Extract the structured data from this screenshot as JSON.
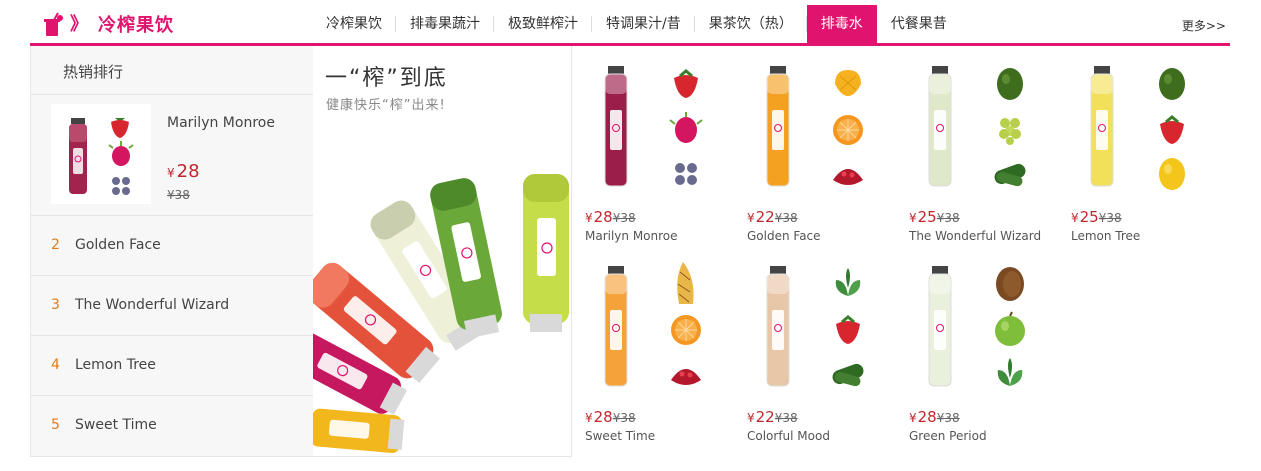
{
  "brand": {
    "arrow": "》",
    "title": "冷榨果饮",
    "icon": "juice-cup-icon",
    "accent": "#e0146e"
  },
  "nav": {
    "items": [
      {
        "label": "冷榨果饮",
        "active": false
      },
      {
        "label": "排毒果蔬汁",
        "active": false
      },
      {
        "label": "极致鲜榨汁",
        "active": false
      },
      {
        "label": "特调果汁/昔",
        "active": false
      },
      {
        "label": "果茶饮（热）",
        "active": false
      },
      {
        "label": "排毒水",
        "active": true
      },
      {
        "label": "代餐果昔",
        "active": false
      }
    ],
    "more": "更多>>"
  },
  "ranking": {
    "title": "热销排行",
    "top": {
      "name": "Marilyn Monroe",
      "yen": "¥",
      "price": "28",
      "old_price": "¥38"
    },
    "items": [
      {
        "num": "2",
        "name": "Golden Face"
      },
      {
        "num": "3",
        "name": "The Wonderful Wizard"
      },
      {
        "num": "4",
        "name": "Lemon Tree"
      },
      {
        "num": "5",
        "name": "Sweet Time"
      }
    ]
  },
  "banner": {
    "title": "一“榨”到底",
    "subtitle": "健康快乐“榨”出来!"
  },
  "products": [
    {
      "name": "Marilyn Monroe",
      "yen": "¥",
      "price": "28",
      "old_price": "¥38",
      "juice": "#9b1d4a",
      "fruits": [
        "strawberry",
        "dragonfruit",
        "blueberry"
      ]
    },
    {
      "name": "Golden Face",
      "yen": "¥",
      "price": "22",
      "old_price": "¥38",
      "juice": "#f4a020",
      "fruits": [
        "mango",
        "orange",
        "pomegranate"
      ]
    },
    {
      "name": "The Wonderful Wizard",
      "yen": "¥",
      "price": "25",
      "old_price": "¥38",
      "juice": "#dfe8c8",
      "fruits": [
        "lime",
        "grape",
        "cucumber"
      ]
    },
    {
      "name": "Lemon Tree",
      "yen": "¥",
      "price": "25",
      "old_price": "¥38",
      "juice": "#f3e05a",
      "fruits": [
        "lime",
        "strawberry",
        "lemon"
      ]
    },
    {
      "name": "Sweet Time",
      "yen": "¥",
      "price": "28",
      "old_price": "¥38",
      "juice": "#f6a23a",
      "fruits": [
        "pineapple",
        "orange",
        "pomegranate"
      ]
    },
    {
      "name": "Colorful Mood",
      "yen": "¥",
      "price": "22",
      "old_price": "¥38",
      "juice": "#e8c6a8",
      "fruits": [
        "mint",
        "strawberry",
        "cucumber"
      ]
    },
    {
      "name": "Green Period",
      "yen": "¥",
      "price": "28",
      "old_price": "¥38",
      "juice": "#e9f0dc",
      "fruits": [
        "kiwi",
        "apple",
        "mint"
      ]
    }
  ]
}
